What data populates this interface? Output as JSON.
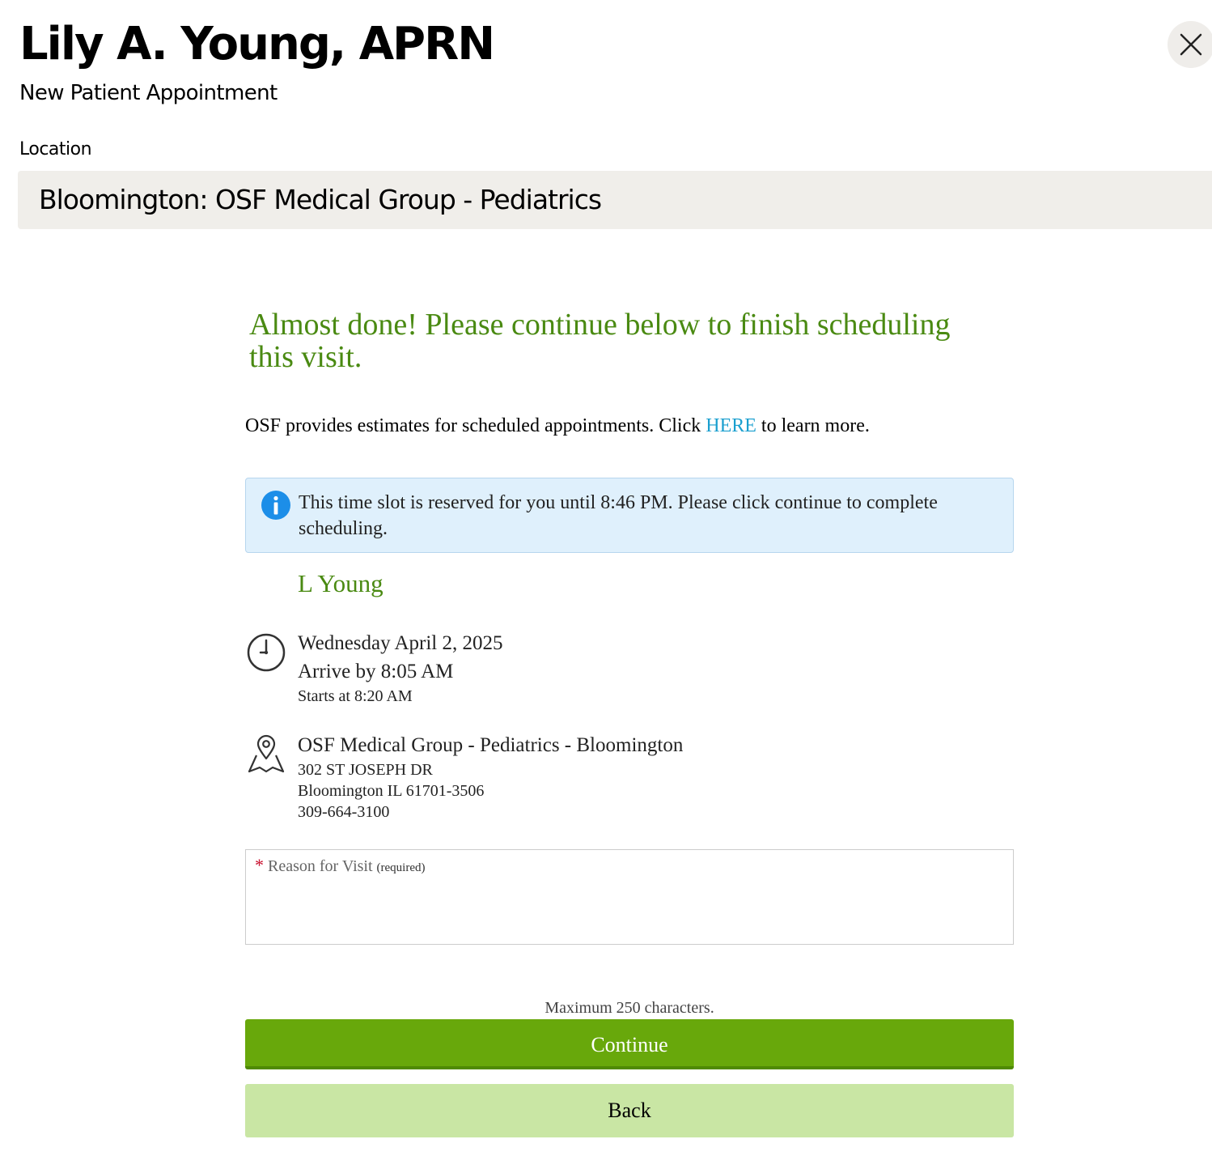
{
  "header": {
    "provider_name": "Lily A. Young, APRN",
    "appointment_type": "New Patient Appointment",
    "close_icon": "close-icon"
  },
  "location": {
    "label": "Location",
    "selected": "Bloomington: OSF Medical Group - Pediatrics"
  },
  "main": {
    "heading": "Almost done! Please continue below to finish scheduling this visit.",
    "estimate_before": "OSF provides estimates for scheduled appointments. Click ",
    "estimate_link": "HERE",
    "estimate_after": " to learn more.",
    "info_icon": "info-icon",
    "info_message": "This time slot is reserved for you until 8:46 PM. Please click continue to complete scheduling."
  },
  "appointment": {
    "patient_name": "L Young",
    "clock_icon": "clock-icon",
    "date": "Wednesday April 2, 2025",
    "arrive_by": "Arrive by 8:05 AM",
    "starts_at": "Starts at 8:20 AM",
    "map_icon": "map-pin-icon",
    "clinic_name": "OSF Medical Group - Pediatrics - Bloomington",
    "address_line1": "302 ST JOSEPH DR",
    "address_line2": "Bloomington IL 61701-3506",
    "phone": "309-664-3100"
  },
  "reason": {
    "required_mark": "*",
    "label": "Reason for Visit",
    "required_note": "(required)",
    "value": "",
    "max_chars_note": "Maximum 250 characters."
  },
  "buttons": {
    "continue_label": "Continue",
    "back_label": "Back"
  },
  "colors": {
    "accent_green": "#4a8a12",
    "continue_button": "#68a80b",
    "back_button": "#c9e6a4",
    "link_blue": "#1a9fcf",
    "info_background": "#dff0fc",
    "info_icon_blue": "#1c8ee8",
    "location_background": "#f0eeea",
    "required_red": "#c8102e"
  }
}
